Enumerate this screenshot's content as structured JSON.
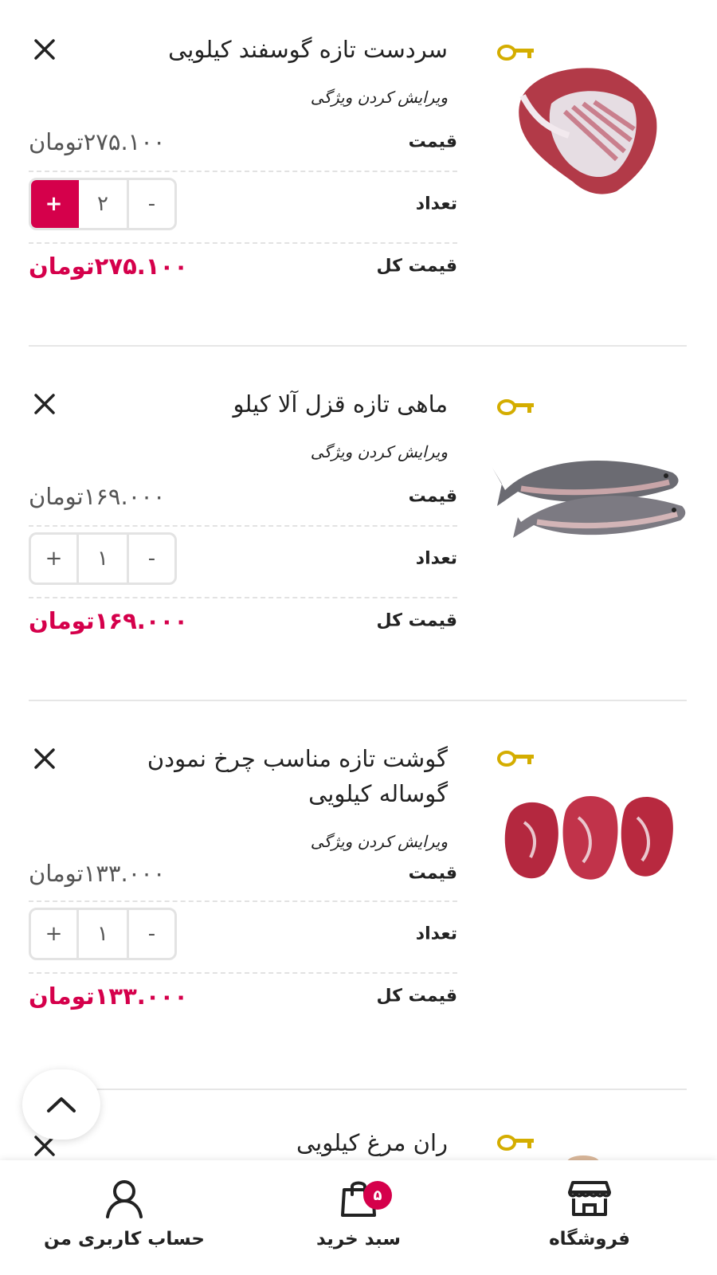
{
  "cart": {
    "labels": {
      "price": "قیمت",
      "quantity": "تعداد",
      "total": "قیمت کل",
      "edit": "ویرایش کردن ویژگی",
      "minus": "-",
      "plus": "+"
    },
    "items": [
      {
        "title": "سردست تازه گوسفند کیلویی",
        "price": "۲۷۵.۱۰۰تومان",
        "quantity": "۲",
        "total": "۲۷۵.۱۰۰تومان",
        "image": "lamb-shoulder-image"
      },
      {
        "title": "ماهی تازه قزل آلا کیلو",
        "price": "۱۶۹.۰۰۰تومان",
        "quantity": "۱",
        "total": "۱۶۹.۰۰۰تومان",
        "image": "trout-fish-image"
      },
      {
        "title": "گوشت تازه مناسب چرخ نمودن گوساله کیلویی",
        "price": "۱۳۳.۰۰۰تومان",
        "quantity": "۱",
        "total": "۱۳۳.۰۰۰تومان",
        "image": "veal-meat-image"
      },
      {
        "title": "ران مرغ کیلویی",
        "image": "chicken-thigh-image"
      }
    ]
  },
  "bottom_nav": {
    "shop": {
      "label": "فروشگاه",
      "icon": "store-icon"
    },
    "cart": {
      "label": "سبد خرید",
      "icon": "shopping-bag-icon",
      "badge": "۵"
    },
    "account": {
      "label": "حساب کاربری من",
      "icon": "user-icon"
    }
  },
  "colors": {
    "accent": "#d5004b",
    "text": "#222222",
    "muted": "#555555",
    "divider": "#e6e6e6"
  }
}
